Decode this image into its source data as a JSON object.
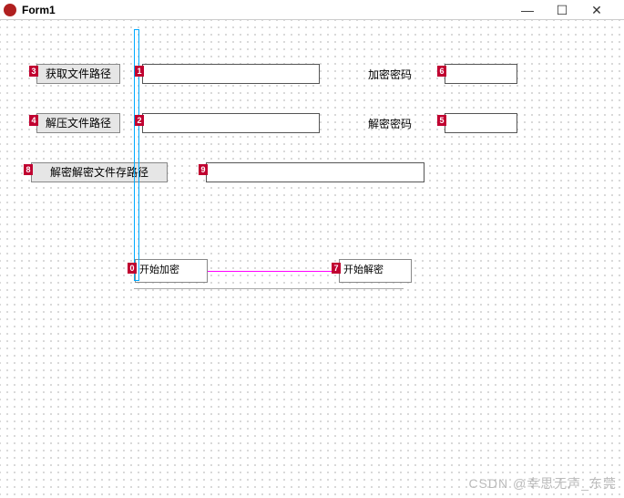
{
  "window": {
    "title": "Form1",
    "min": "—",
    "max": "☐",
    "close": "✕"
  },
  "buttons": {
    "get_file_path": "获取文件路径",
    "unzip_file_path": "解压文件路径",
    "decrypt_store_path": "解密解密文件存路径"
  },
  "labels": {
    "encrypt_password": "加密密码",
    "decrypt_password": "解密密码"
  },
  "tabs": {
    "start_encrypt": "开始加密",
    "start_decrypt": "开始解密"
  },
  "inputs": {
    "path1": "",
    "path2": "",
    "path3": "",
    "enc_pwd": "",
    "dec_pwd": ""
  },
  "tags": {
    "t0": "0",
    "t1": "1",
    "t2": "2",
    "t3": "3",
    "t4": "4",
    "t5": "5",
    "t6": "6",
    "t7": "7",
    "t8": "8",
    "t9": "9"
  },
  "watermark": "CSDN @幸思无声_东莞"
}
